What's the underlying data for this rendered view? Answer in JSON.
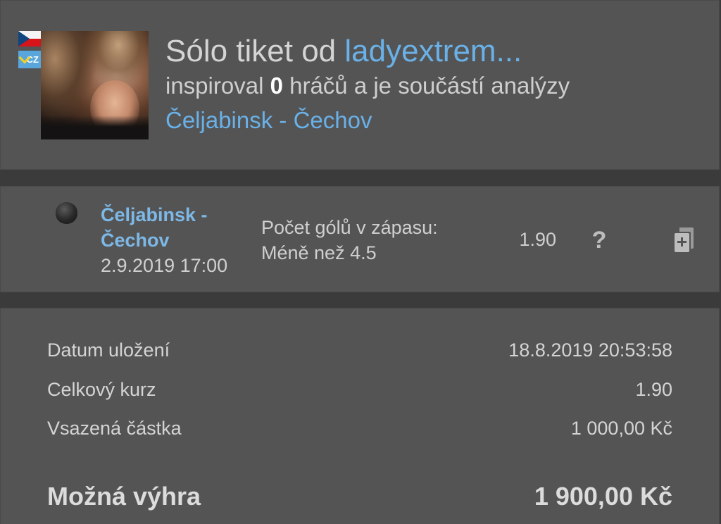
{
  "header": {
    "title_prefix": "Sólo tiket od ",
    "author": "ladyextrem...",
    "sub_pre": "inspiroval ",
    "inspired_count": "0",
    "sub_post": " hráčů a je součástí analýzy",
    "match_link": "Čeljabinsk - Čechov",
    "language_badge": "CZ"
  },
  "bet": {
    "match": "Čeljabinsk - Čechov",
    "datetime": "2.9.2019 17:00",
    "market": "Počet gólů v zápasu:",
    "selection": "Méně než 4.5",
    "odds": "1.90",
    "help_glyph": "?",
    "status_icon": "status-dot-icon",
    "copy_icon": "add-to-ticket-icon"
  },
  "summary": {
    "rows": [
      {
        "label": "Datum uložení",
        "value": "18.8.2019 20:53:58"
      },
      {
        "label": "Celkový kurz",
        "value": "1.90"
      },
      {
        "label": "Vsazená částka",
        "value": "1 000,00 Kč"
      }
    ],
    "total_label": "Možná výhra",
    "total_value": "1 900,00 Kč"
  },
  "colors": {
    "background": "#3b3b3b",
    "panel": "#545454",
    "link": "#6ab1e8",
    "text": "#d4d4d4"
  }
}
